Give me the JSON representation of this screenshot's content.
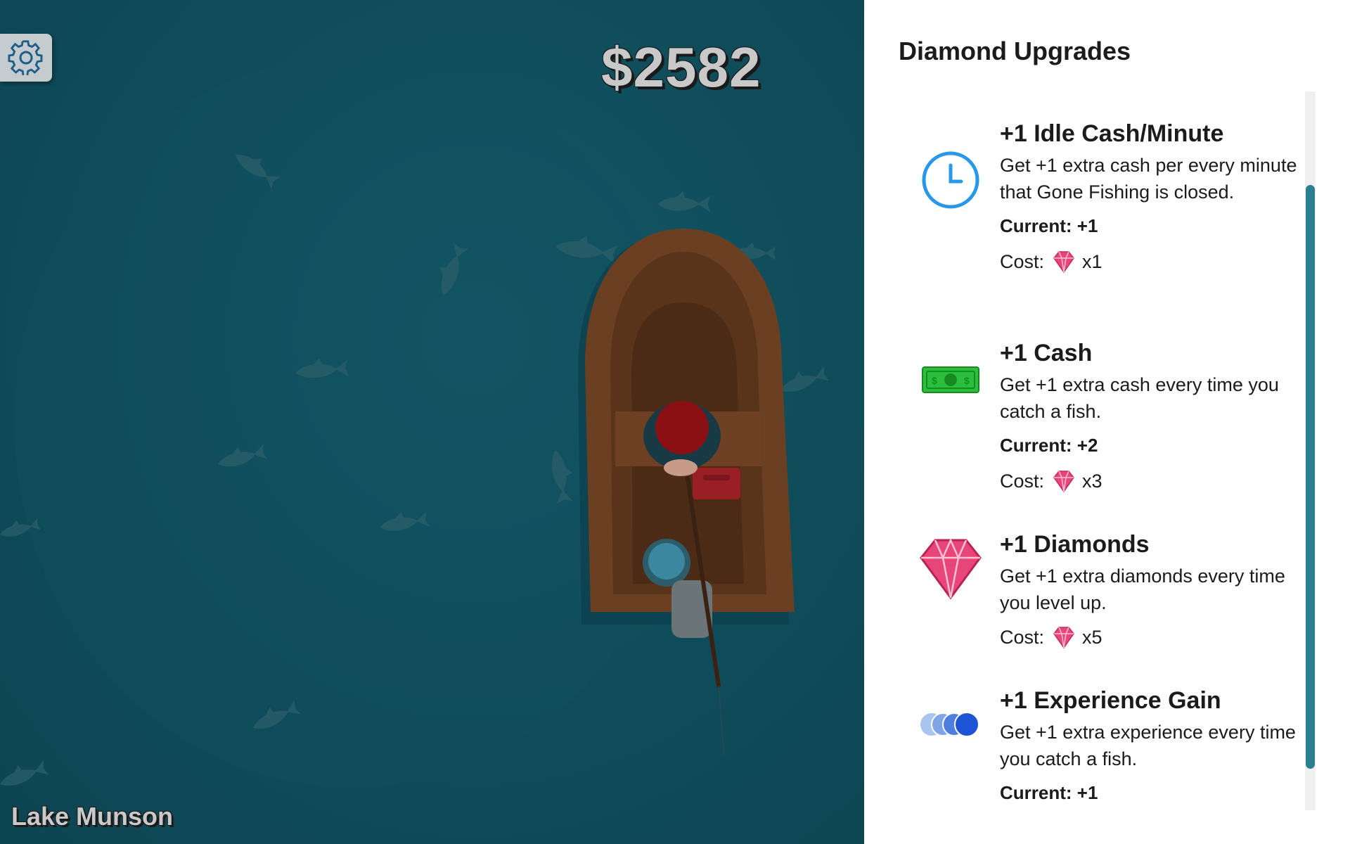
{
  "game": {
    "money": "$2582",
    "location": "Lake Munson",
    "settings_icon": "gear-icon"
  },
  "panel": {
    "title": "Diamond Upgrades",
    "upgrades": [
      {
        "name": "+1 Idle Cash/Minute",
        "description": "Get +1 extra cash per every minute that Gone Fishing is closed.",
        "current": "Current: +1",
        "cost_label": "Cost:",
        "cost_value": "x1",
        "icon": "clock-icon"
      },
      {
        "name": "+1 Cash",
        "description": "Get +1 extra cash every time you catch a fish.",
        "current": "Current: +2",
        "cost_label": "Cost:",
        "cost_value": "x3",
        "icon": "dollar-bill-icon"
      },
      {
        "name": "+1 Diamonds",
        "description": "Get +1 extra diamonds every time you level up.",
        "cost_label": "Cost:",
        "cost_value": "x5",
        "icon": "diamond-icon"
      },
      {
        "name": "+1 Experience Gain",
        "description": "Get +1 extra experience every time you catch a fish.",
        "current": "Current: +1",
        "icon": "experience-orbs-icon"
      }
    ]
  },
  "colors": {
    "water": "#0f4c5a",
    "accent": "#2b7f91",
    "diamond": "#e8457a",
    "boat": "#6b3f22"
  }
}
